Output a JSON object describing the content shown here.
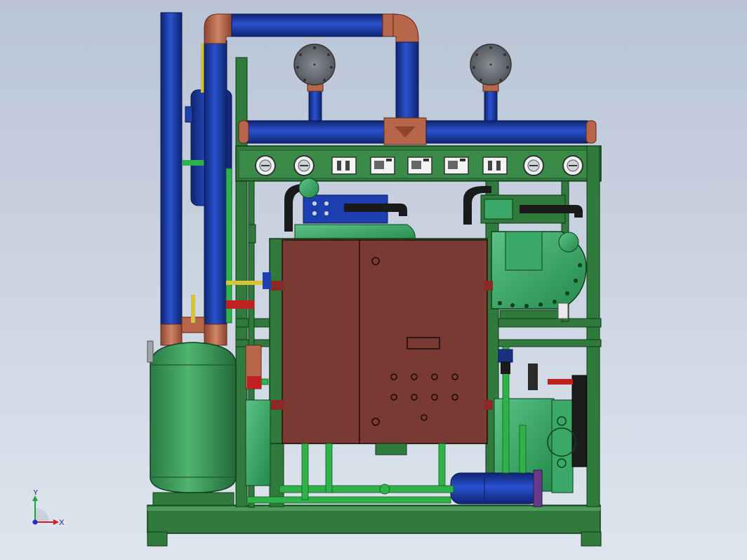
{
  "view": {
    "background_top": "#b9c4d6",
    "background_bottom": "#dfe5ee"
  },
  "triad": {
    "x_label": "X",
    "y_label": "Y",
    "x_color": "#d42020",
    "y_color": "#20a040",
    "z_color": "#2030c0"
  },
  "colors": {
    "frame": "#2f7a3c",
    "frame_dark": "#1f5a2a",
    "pipe_blue": "#1d3fb0",
    "pipe_blue_dark": "#0f2470",
    "copper": "#b8664a",
    "tank_green": "#3c9e5a",
    "panel": "#7a3a34",
    "compressor": "#3aa866",
    "gauge": "#6a6e74"
  }
}
